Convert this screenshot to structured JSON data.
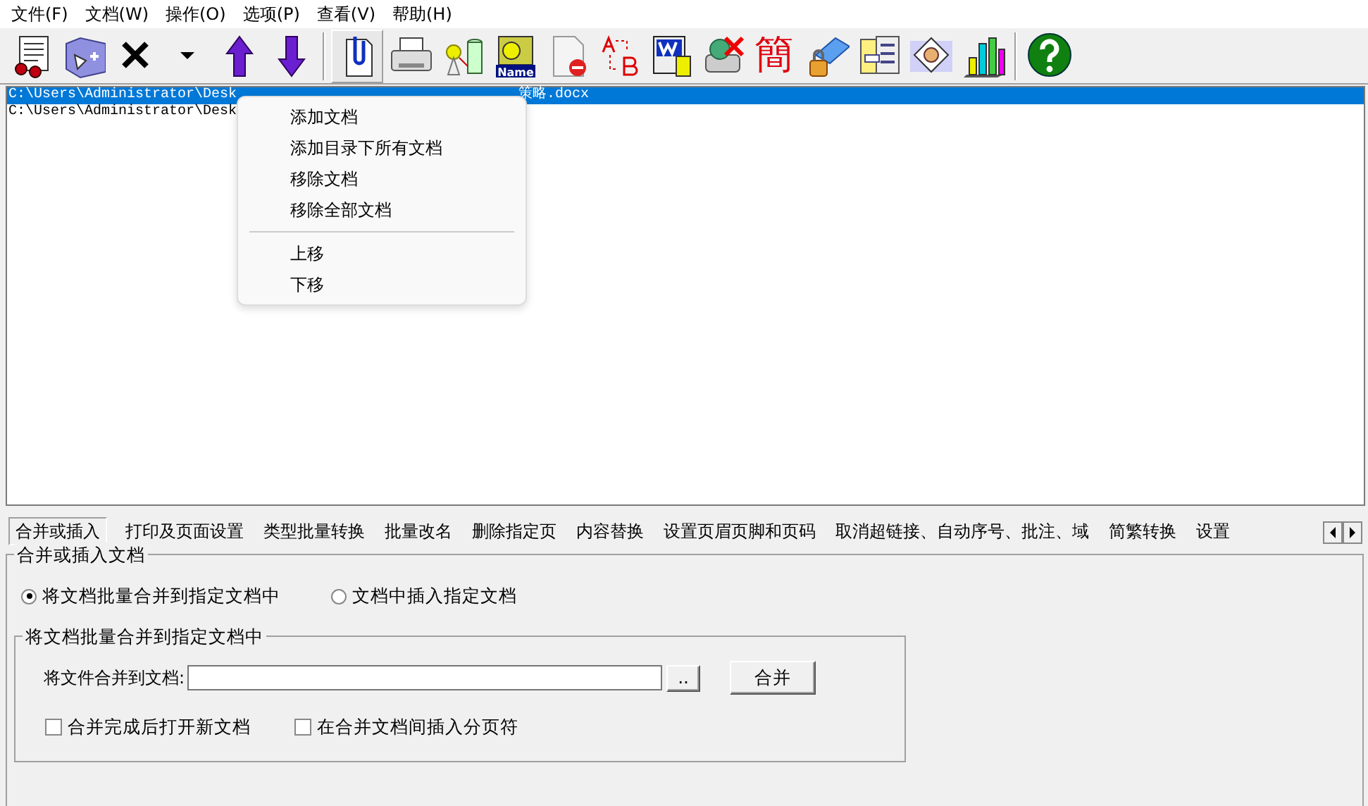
{
  "menu_bar": [
    "文件(F)",
    "文档(W)",
    "操作(O)",
    "选项(P)",
    "查看(V)",
    "帮助(H)"
  ],
  "toolbar": [
    {
      "kind": "button",
      "pressed": false
    },
    {
      "kind": "button",
      "pressed": false
    },
    {
      "kind": "button",
      "pressed": false
    },
    {
      "kind": "button",
      "pressed": false
    },
    {
      "kind": "button",
      "pressed": false
    },
    {
      "kind": "button",
      "pressed": false
    },
    {
      "kind": "separator"
    },
    {
      "kind": "button",
      "pressed": true
    },
    {
      "kind": "button",
      "pressed": false
    },
    {
      "kind": "button",
      "pressed": false
    },
    {
      "kind": "button",
      "pressed": false,
      "text": "Name"
    },
    {
      "kind": "button",
      "pressed": false
    },
    {
      "kind": "button",
      "pressed": false
    },
    {
      "kind": "button",
      "pressed": false
    },
    {
      "kind": "button",
      "pressed": false
    },
    {
      "kind": "text_button",
      "pressed": false,
      "text": "簡"
    },
    {
      "kind": "button",
      "pressed": false
    },
    {
      "kind": "button",
      "pressed": false
    },
    {
      "kind": "button",
      "pressed": false
    },
    {
      "kind": "button",
      "pressed": false
    },
    {
      "kind": "separator"
    },
    {
      "kind": "button",
      "pressed": false
    }
  ],
  "file_list": [
    {
      "path": "C:\\Users\\Administrator\\Desk",
      "tail": "策略.docx",
      "selected": true
    },
    {
      "path": "C:\\Users\\Administrator\\Desk",
      "selected": false
    }
  ],
  "context_menu": {
    "sections": [
      [
        "添加文档",
        "添加目录下所有文档",
        "移除文档",
        "移除全部文档"
      ],
      [
        "上移",
        "下移"
      ]
    ]
  },
  "tabs": [
    {
      "label": "合并或插入",
      "selected": true
    },
    {
      "label": "打印及页面设置",
      "selected": false
    },
    {
      "label": "类型批量转换",
      "selected": false
    },
    {
      "label": "批量改名",
      "selected": false
    },
    {
      "label": "删除指定页",
      "selected": false
    },
    {
      "label": "内容替换",
      "selected": false
    },
    {
      "label": "设置页眉页脚和页码",
      "selected": false
    },
    {
      "label": "取消超链接、自动序号、批注、域",
      "selected": false
    },
    {
      "label": "简繁转换",
      "selected": false
    },
    {
      "label": "设置",
      "selected": false
    }
  ],
  "panel": {
    "title": "合并或插入文档",
    "modes": [
      {
        "label": "将文档批量合并到指定文档中",
        "selected": true
      },
      {
        "label": "文档中插入指定文档",
        "selected": false
      }
    ],
    "group": {
      "title": "将文档批量合并到指定文档中",
      "field_label": "将文件合并到文档:",
      "browse_button": "..",
      "merge_button": "合并",
      "options": [
        {
          "label": "合并完成后打开新文档",
          "checked": false
        },
        {
          "label": "在合并文档间插入分页符",
          "checked": false
        }
      ]
    }
  }
}
